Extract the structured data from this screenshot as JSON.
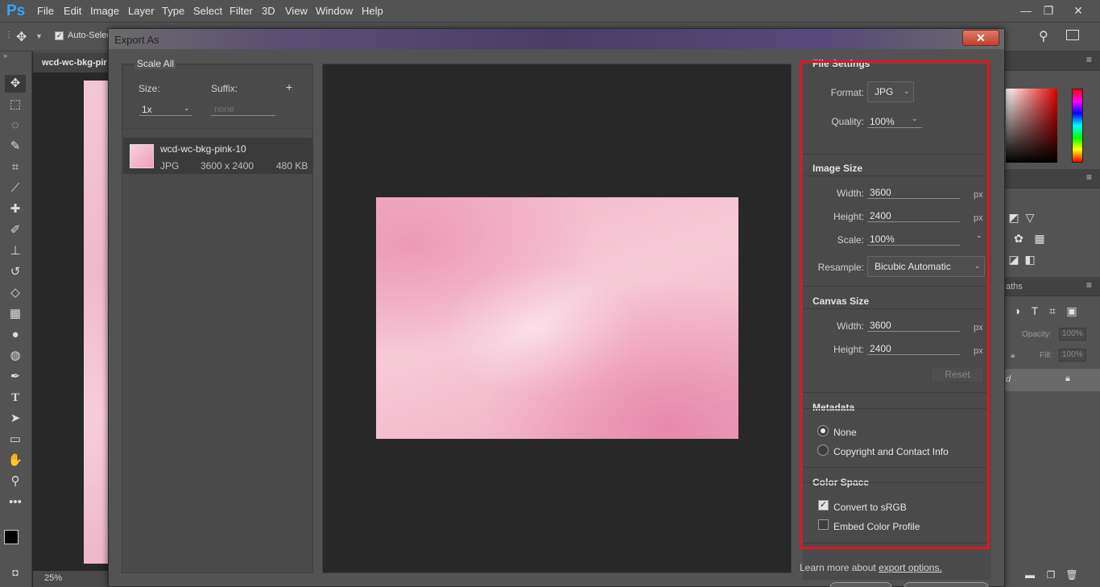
{
  "app": {
    "logo": "Ps",
    "menu": [
      "File",
      "Edit",
      "Image",
      "Layer",
      "Type",
      "Select",
      "Filter",
      "3D",
      "View",
      "Window",
      "Help"
    ],
    "window_controls": {
      "minimize": "—",
      "restore": "❐",
      "close": "✕"
    }
  },
  "options_bar": {
    "auto_select_label": "Auto-Selec"
  },
  "document": {
    "tab_title": "wcd-wc-bkg-pir",
    "zoom": "25%"
  },
  "right_panel": {
    "paths_tab": "aths",
    "opacity_label": "Opacity:",
    "opacity_value": "100%",
    "fill_label": "Fill:",
    "fill_value": "100%",
    "layer_name": "d"
  },
  "dialog": {
    "title": "Export As",
    "close_label": "✕",
    "scale_all": {
      "header": "Scale All",
      "size_label": "Size:",
      "size_value": "1x",
      "suffix_label": "Suffix:",
      "suffix_placeholder": "none",
      "add_label": "+"
    },
    "asset": {
      "name": "wcd-wc-bkg-pink-10",
      "format": "JPG",
      "dimensions": "3600 x 2400",
      "filesize": "480 KB"
    },
    "file_settings": {
      "header": "File Settings",
      "format_label": "Format:",
      "format_value": "JPG",
      "quality_label": "Quality:",
      "quality_value": "100%"
    },
    "image_size": {
      "header": "Image Size",
      "width_label": "Width:",
      "width_value": "3600",
      "height_label": "Height:",
      "height_value": "2400",
      "scale_label": "Scale:",
      "scale_value": "100%",
      "resample_label": "Resample:",
      "resample_value": "Bicubic Automatic",
      "unit": "px"
    },
    "canvas_size": {
      "header": "Canvas Size",
      "width_label": "Width:",
      "width_value": "3600",
      "height_label": "Height:",
      "height_value": "2400",
      "unit": "px",
      "reset_label": "Reset"
    },
    "metadata": {
      "header": "Metadata",
      "options": [
        {
          "label": "None",
          "selected": true
        },
        {
          "label": "Copyright and Contact Info",
          "selected": false
        }
      ]
    },
    "color_space": {
      "header": "Color Space",
      "convert_label": "Convert to sRGB",
      "convert_checked": true,
      "embed_label": "Embed Color Profile",
      "embed_checked": false
    },
    "footer": {
      "learn_text": "Learn more about",
      "learn_link": "export options."
    }
  },
  "colors": {
    "highlight_outline": "#e3141e",
    "ps_blue": "#31a8ff",
    "dialog_bg": "#535353"
  }
}
